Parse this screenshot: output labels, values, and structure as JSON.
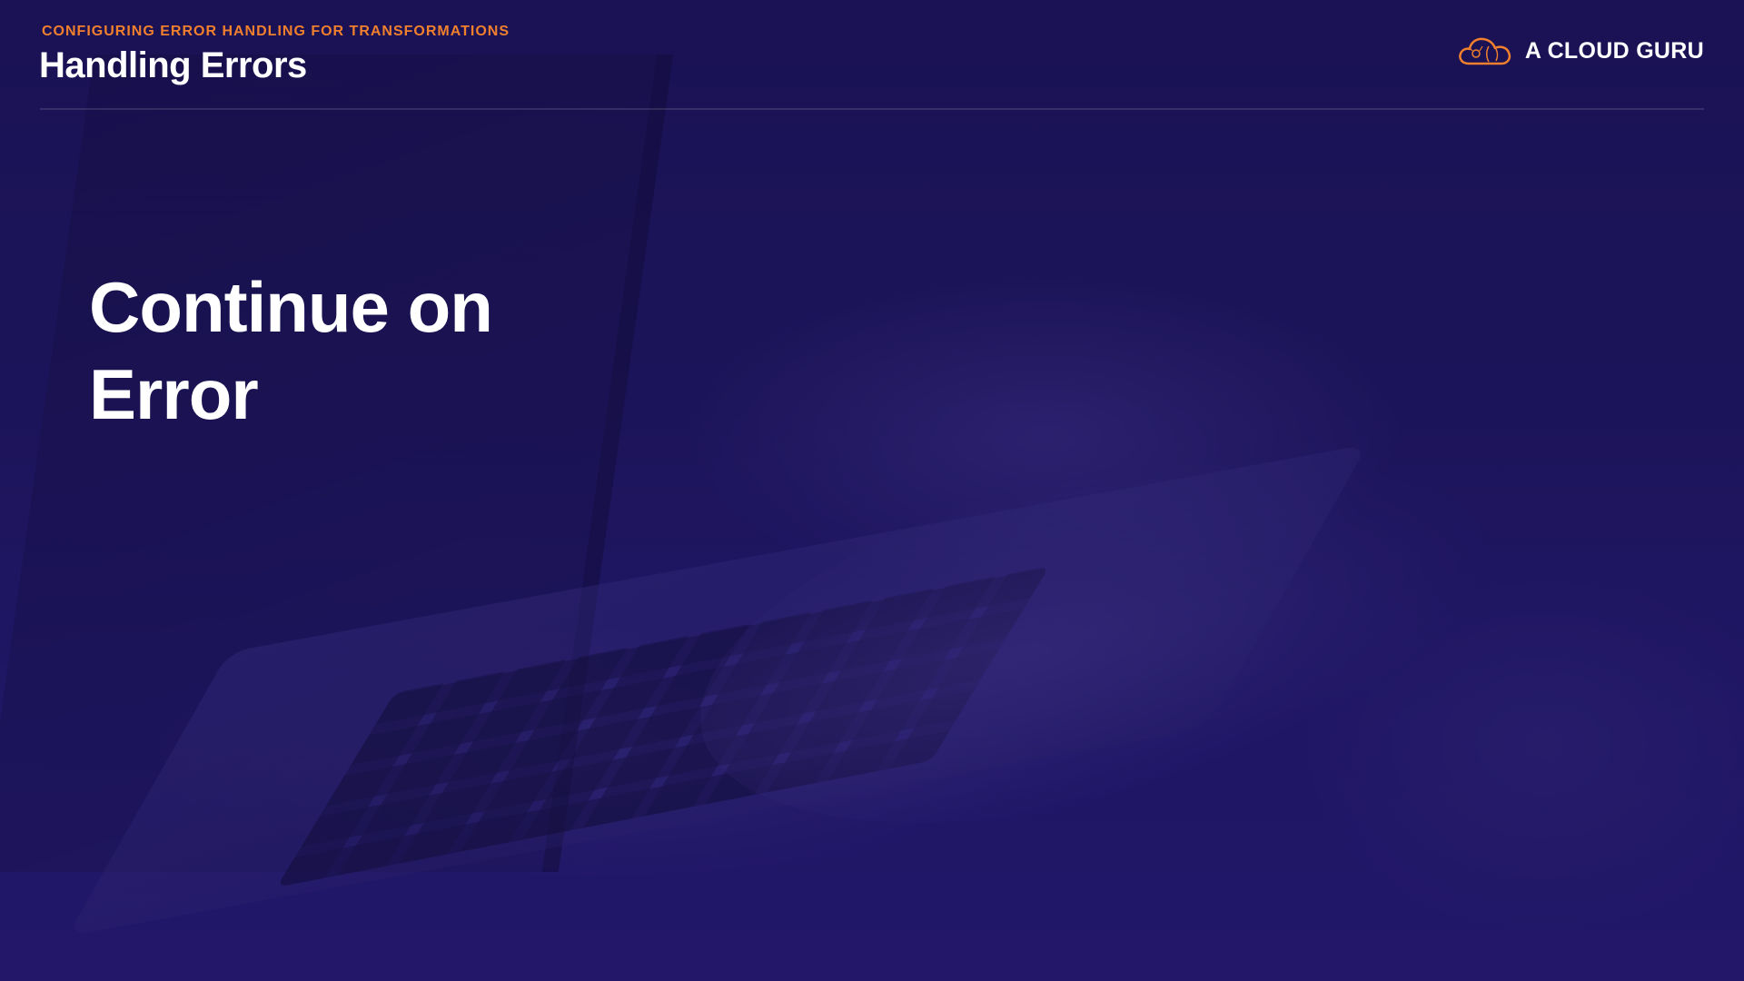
{
  "header": {
    "kicker": "CONFIGURING ERROR HANDLING FOR TRANSFORMATIONS",
    "title": "Handling Errors"
  },
  "brand": {
    "logo_icon": "cloud-logo-icon",
    "name": "A CLOUD GURU",
    "accent_color": "#f07f2e"
  },
  "main": {
    "title_line1": "Continue on",
    "title_line2": "Error"
  },
  "colors": {
    "background": "#1e1656",
    "text": "#ffffff",
    "kicker": "#f07f2e"
  }
}
